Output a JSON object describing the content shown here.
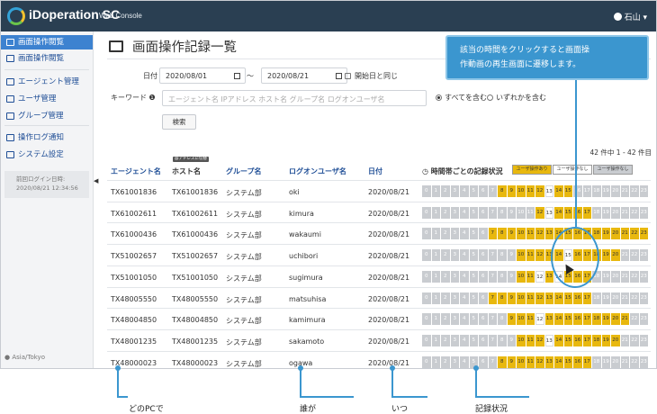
{
  "app": {
    "name": "iDoperation SC",
    "subtitle": "Web Console",
    "user": "石山"
  },
  "sidebar": {
    "items": [
      {
        "label": "画面操作閲覧",
        "active": true,
        "icon": "monitor-icon"
      },
      {
        "label": "画面操作閲覧",
        "active": false,
        "icon": "search-icon"
      },
      {
        "label": "エージェント管理",
        "active": false,
        "icon": "video-icon"
      },
      {
        "label": "ユーザ管理",
        "active": false,
        "icon": "user-icon"
      },
      {
        "label": "グループ管理",
        "active": false,
        "icon": "group-icon"
      },
      {
        "label": "操作ログ通知",
        "active": false,
        "icon": "megaphone-icon"
      },
      {
        "label": "システム設定",
        "active": false,
        "icon": "wrench-icon"
      }
    ],
    "last_login_label": "前回ログイン日時:",
    "last_login_value": "2020/08/21 12:34:56",
    "timezone": "Asia/Tokyo"
  },
  "page": {
    "title": "画面操作記録一覧"
  },
  "filters": {
    "date_label": "日付",
    "date_from": "2020/08/01",
    "date_sep": "〜",
    "date_to": "2020/08/21",
    "same_day_label": "開始日と同じ",
    "keyword_label": "キーワード",
    "keyword_placeholder": "エージェント名 IPアドレス ホスト名 グループ名 ログオンユーザ名",
    "match_all_label": "すべてを含む",
    "match_any_label": "いずれかを含む",
    "search_button": "検索"
  },
  "results": {
    "count_text": "42 件中 1 - 42 件目"
  },
  "table": {
    "columns": [
      "エージェント名",
      "ホスト名",
      "グループ名",
      "ログオンユーザ名",
      "日付",
      "時間帯ごとの記録状況"
    ],
    "host_tag": "@アドレスに切替",
    "legend": [
      "ユーザ操作あり",
      "ユーザ操作なし",
      "ユーザ操作なし"
    ],
    "hours": [
      "0",
      "1",
      "2",
      "3",
      "4",
      "5",
      "6",
      "7",
      "8",
      "9",
      "10",
      "11",
      "12",
      "13",
      "14",
      "15",
      "16",
      "17",
      "18",
      "19",
      "20",
      "21",
      "22",
      "23"
    ],
    "rows": [
      {
        "agent": "TX61001836",
        "host": "TX61001836",
        "group": "システム部",
        "user": "oki",
        "date": "2020/08/21",
        "slots": "nnnnnnnnyyyyywyynnnnnnnn"
      },
      {
        "agent": "TX61002611",
        "host": "TX61002611",
        "group": "システム部",
        "user": "kimura",
        "date": "2020/08/21",
        "slots": "nnnnnnnnnnnnywyyyynnnnnn"
      },
      {
        "agent": "TX61000436",
        "host": "TX61000436",
        "group": "システム部",
        "user": "wakaumi",
        "date": "2020/08/21",
        "slots": "nnnnnnnyyyyyyyyyyyyyyyyy"
      },
      {
        "agent": "TX51002657",
        "host": "TX51002657",
        "group": "システム部",
        "user": "uchibori",
        "date": "2020/08/21",
        "slots": "nnnnnnnnnnyyyyywyyyyynnn"
      },
      {
        "agent": "TX51001050",
        "host": "TX51001050",
        "group": "システム部",
        "user": "sugimura",
        "date": "2020/08/21",
        "slots": "nnnnnnnnnnyywywyyynnnnnn"
      },
      {
        "agent": "TX48005550",
        "host": "TX48005550",
        "group": "システム部",
        "user": "matsuhisa",
        "date": "2020/08/21",
        "slots": "nnnnnnnyyyyyyyyyyynnnnnn"
      },
      {
        "agent": "TX48004850",
        "host": "TX48004850",
        "group": "システム部",
        "user": "kamimura",
        "date": "2020/08/21",
        "slots": "nnnnnnnnnyyywyyyyyyyyynn"
      },
      {
        "agent": "TX48001235",
        "host": "TX48001235",
        "group": "システム部",
        "user": "sakamoto",
        "date": "2020/08/21",
        "slots": "nnnnnnnnnnyyywyyyyyyynnn"
      },
      {
        "agent": "TX48000023",
        "host": "TX48000023",
        "group": "システム部",
        "user": "ogawa",
        "date": "2020/08/21",
        "slots": "nnnnnnnnyyyyyyyyyynnnnnn"
      }
    ]
  },
  "callout": {
    "line1": "該当の時間をクリックすると画面操",
    "line2": "作動画の再生画面に遷移します。"
  },
  "annotations": {
    "what_pc": "どのPCで",
    "who": "誰が",
    "when": "いつ",
    "status": "記録状況"
  },
  "colors": {
    "topbar": "#2a3f52",
    "accent": "#3b96cf",
    "recorded": "#e8b80e",
    "none": "#c9ccd0"
  }
}
